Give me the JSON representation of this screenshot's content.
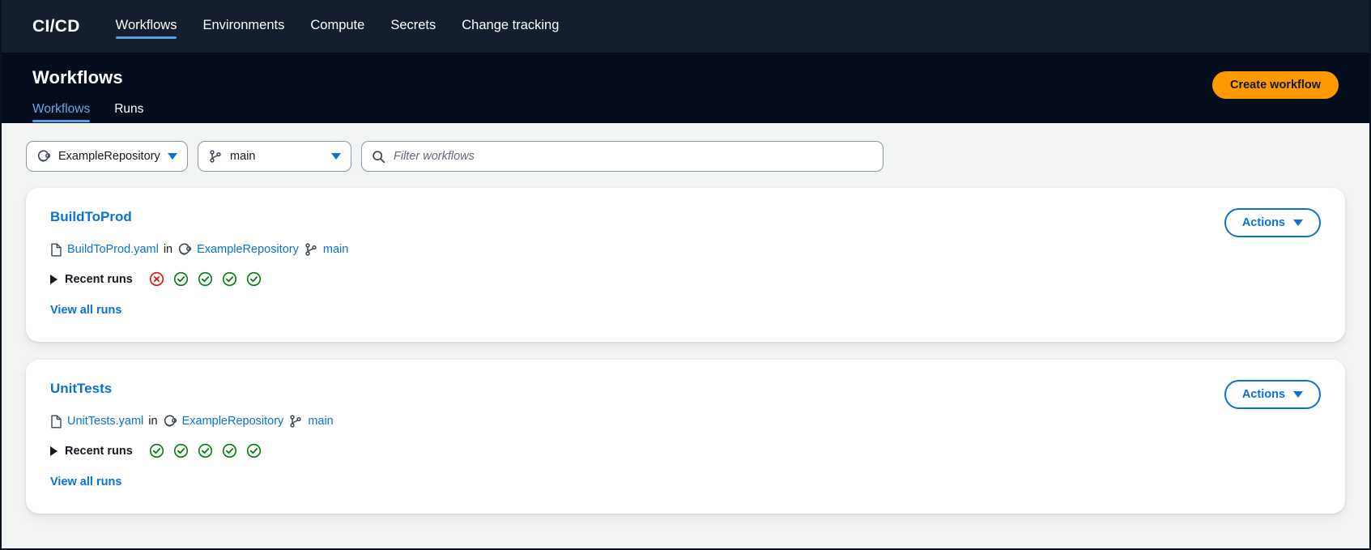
{
  "topnav": {
    "brand": "CI/CD",
    "items": [
      {
        "label": "Workflows",
        "active": true
      },
      {
        "label": "Environments",
        "active": false
      },
      {
        "label": "Compute",
        "active": false
      },
      {
        "label": "Secrets",
        "active": false
      },
      {
        "label": "Change tracking",
        "active": false
      }
    ]
  },
  "header": {
    "title": "Workflows",
    "tabs": [
      {
        "label": "Workflows",
        "active": true
      },
      {
        "label": "Runs",
        "active": false
      }
    ],
    "create_button": "Create workflow"
  },
  "filters": {
    "repository": {
      "value": "ExampleRepository",
      "icon": "repository-icon"
    },
    "branch": {
      "value": "main",
      "icon": "branch-icon"
    },
    "search": {
      "placeholder": "Filter workflows",
      "value": "",
      "icon": "search-icon"
    }
  },
  "colors": {
    "topnav_bg": "#141e2d",
    "header_bg": "#060d1c",
    "content_bg": "#f2f3f3",
    "link": "#0972d3",
    "accent_orange": "#ff9900",
    "tab_underline": "#539fe5",
    "status_success": "#037f0c",
    "status_failed": "#d91515",
    "border_gray": "#8d99a8"
  },
  "workflows": [
    {
      "name": "BuildToProd",
      "file": "BuildToProd.yaml",
      "in_word": "in",
      "repository": "ExampleRepository",
      "branch": "main",
      "recent_runs_label": "Recent runs",
      "recent_runs": [
        "failed",
        "success",
        "success",
        "success",
        "success"
      ],
      "view_all_label": "View all runs",
      "actions_label": "Actions"
    },
    {
      "name": "UnitTests",
      "file": "UnitTests.yaml",
      "in_word": "in",
      "repository": "ExampleRepository",
      "branch": "main",
      "recent_runs_label": "Recent runs",
      "recent_runs": [
        "success",
        "success",
        "success",
        "success",
        "success"
      ],
      "view_all_label": "View all runs",
      "actions_label": "Actions"
    }
  ]
}
